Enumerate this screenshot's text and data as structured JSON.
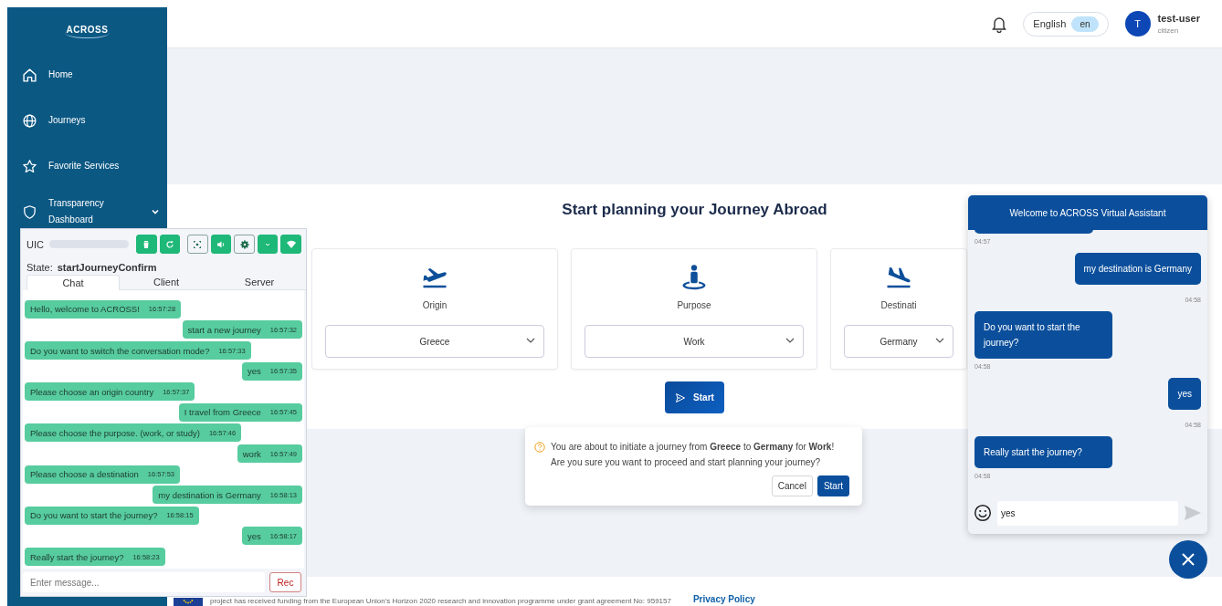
{
  "sidebar": {
    "logo": "ACROSS",
    "items": [
      {
        "label": "Home"
      },
      {
        "label": "Journeys"
      },
      {
        "label": "Favorite Services"
      },
      {
        "label": "Transparency Dashboard",
        "expanded": false
      }
    ]
  },
  "header": {
    "language": {
      "label": "English",
      "code": "en",
      "active": true
    },
    "user": {
      "initial": "T",
      "name": "test-user",
      "role": "citizen"
    }
  },
  "planner": {
    "title": "Start planning your Journey Abroad",
    "cards": [
      {
        "label": "Origin",
        "value": "Greece"
      },
      {
        "label": "Purpose",
        "value": "Work"
      },
      {
        "label": "Destinati",
        "value": "Germany"
      }
    ],
    "start_button": "Start"
  },
  "confirm": {
    "message": "You are about to initiate a journey from **Greece** to **Germany** for **Work**!",
    "question": "Are you sure you want to proceed and start planning your journey?",
    "cancel": "Cancel",
    "ok": "Start"
  },
  "footer": {
    "funding": "project has received funding from the European Union's Horizon 2020 research and innovation programme under grant agreement No: 959157",
    "privacy": "Privacy Policy"
  },
  "uic": {
    "title": "UIC",
    "tools": [
      {
        "on": true
      },
      {
        "on": true
      },
      {
        "on": false
      },
      {
        "on": true
      },
      {
        "on": false
      },
      {
        "on": true
      },
      {
        "on": true
      }
    ],
    "state_label": "State:",
    "state": "startJourneyConfirm",
    "tabs": [
      {
        "label": "Chat",
        "selected": true
      },
      {
        "label": "Client",
        "selected": false
      },
      {
        "label": "Server",
        "selected": false
      }
    ],
    "messages": [
      {
        "kind": "bot",
        "text": "Hello, welcome to ACROSS!",
        "time": "16:57:28"
      },
      {
        "kind": "user",
        "text": "start a new journey",
        "time": "16:57:32"
      },
      {
        "kind": "bot",
        "text": "Do you want to switch the conversation mode?",
        "time": "16:57:33"
      },
      {
        "kind": "user",
        "text": "yes",
        "time": "16:57:35"
      },
      {
        "kind": "bot",
        "text": "Please choose an origin country",
        "time": "16:57:37"
      },
      {
        "kind": "user",
        "text": "I travel from Greece",
        "time": "16:57:45"
      },
      {
        "kind": "bot",
        "text": "Please choose the purpose. (work, or study)",
        "time": "16:57:46"
      },
      {
        "kind": "user",
        "text": "work",
        "time": "16:57:49"
      },
      {
        "kind": "bot",
        "text": "Please choose a destination",
        "time": "16:57:53"
      },
      {
        "kind": "user",
        "text": "my destination is Germany",
        "time": "16:58:13"
      },
      {
        "kind": "bot",
        "text": "Do you want to start the journey?",
        "time": "16:58:15"
      },
      {
        "kind": "user",
        "text": "yes",
        "time": "16:58:17"
      },
      {
        "kind": "bot",
        "text": "Really start the journey?",
        "time": "16:58:23"
      }
    ],
    "input": {
      "placeholder": "Enter message..."
    },
    "rec_button": "Rec"
  },
  "assistant": {
    "title": "Welcome to ACROSS Virtual Assistant",
    "messages": [
      {
        "kind": "bot",
        "time": "04:57"
      },
      {
        "kind": "user",
        "text": "my destination is Germany",
        "time": "04:58"
      },
      {
        "kind": "bot",
        "text": "Do you want to start the journey?",
        "time": "04:58"
      },
      {
        "kind": "user",
        "text": "yes",
        "time": "04:58"
      },
      {
        "kind": "bot",
        "text": "Really start the journey?",
        "time": "04:58"
      }
    ],
    "input": {
      "value": "yes"
    }
  }
}
